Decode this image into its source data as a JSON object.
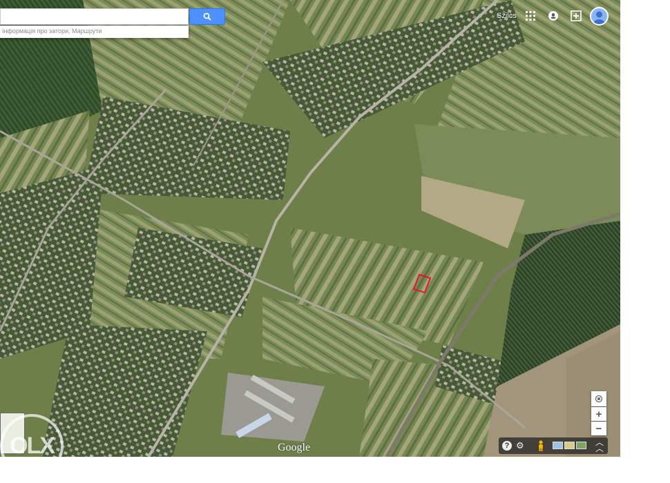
{
  "search": {
    "value": "",
    "placeholder": ""
  },
  "hint": "Інформація про затори, Маршрути",
  "user": {
    "name": "Szilcs"
  },
  "icons": {
    "search": "search-icon",
    "apps": "apps-grid-icon",
    "notifications": "notifications-icon",
    "share": "add-share-icon",
    "avatar": "avatar-icon",
    "location": "my-location-icon",
    "help": "help-icon",
    "settings": "gear-icon",
    "pegman": "pegman-icon",
    "expand": "chevron-up-icon"
  },
  "zoom": {
    "in_label": "+",
    "out_label": "−"
  },
  "watermark": "Google",
  "overlay_watermark": "OLX",
  "colors": {
    "accent": "#4d90fe",
    "marker": "#e8162a"
  }
}
